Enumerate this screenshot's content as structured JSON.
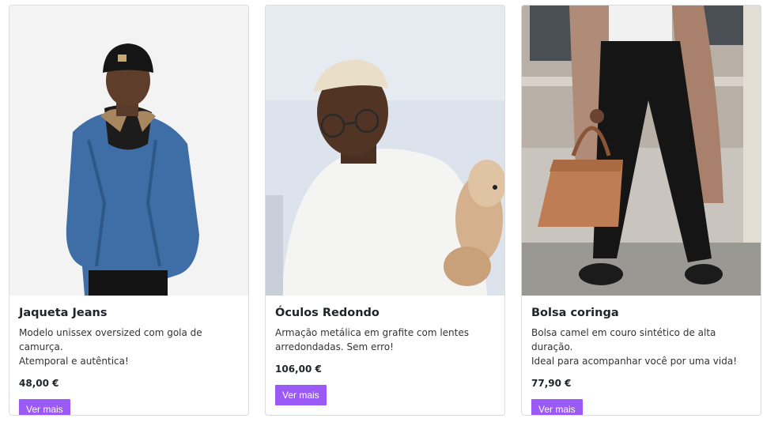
{
  "products": [
    {
      "image_alt": "Jaqueta Jeans",
      "title": "Jaqueta Jeans",
      "description_line1": "Modelo unissex oversized com gola de camurça.",
      "description_line2": "Atemporal e autêntica!",
      "price": "48,00 €",
      "button_label": "Ver mais"
    },
    {
      "image_alt": "Óculos Redondo",
      "title": "Óculos Redondo",
      "description_line1": "Armação metálica em grafite com lentes",
      "description_line2": "arredondadas. Sem erro!",
      "price": "106,00 €",
      "button_label": "Ver mais"
    },
    {
      "image_alt": "Bolsa coringa",
      "title": "Bolsa coringa",
      "description_line1": "Bolsa camel em couro sintético de alta duração.",
      "description_line2": "Ideal para acompanhar você por uma vida!",
      "price": "77,90 €",
      "button_label": "Ver mais"
    }
  ],
  "colors": {
    "button_bg": "#9b59f5",
    "button_text": "#ffffff",
    "card_border": "#dcdcdc"
  }
}
